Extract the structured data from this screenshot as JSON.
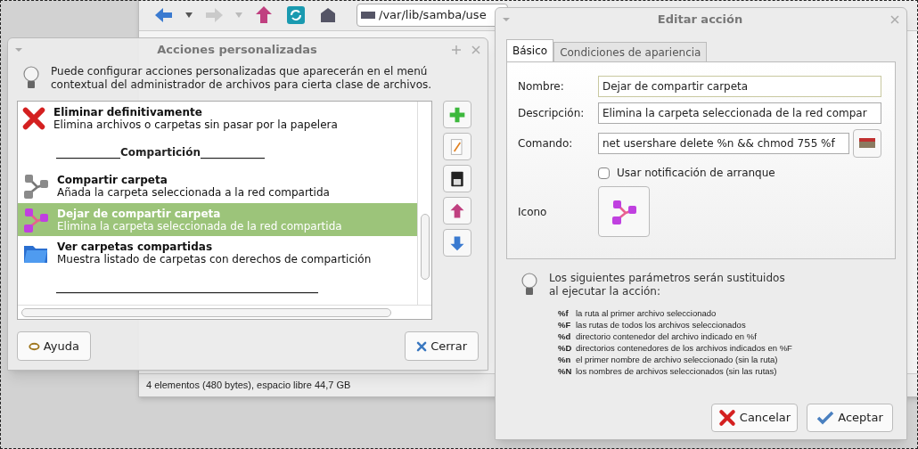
{
  "file_manager": {
    "path": "/var/lib/samba/use",
    "status": "4 elementos (480 bytes), espacio libre 44,7 GB"
  },
  "actions_dialog": {
    "title": "Acciones personalizadas",
    "intro": "Puede configurar acciones personalizadas que aparecerán en el menú contextual del administrador de archivos para cierta clase de archivos.",
    "items": [
      {
        "kind": "action",
        "title": "Eliminar definitivamente",
        "description": "Elimina archivos o carpetas sin pasar por la papelera",
        "selected": false
      },
      {
        "kind": "separator",
        "title": "____________Compartición____________",
        "selected": false
      },
      {
        "kind": "action",
        "title": "Compartir carpeta",
        "description": "Añada la carpeta seleccionada a la red compartida",
        "selected": false
      },
      {
        "kind": "action",
        "title": "Dejar de compartir carpeta",
        "description": "Elimina la carpeta seleccionada de la red compartida",
        "selected": true
      },
      {
        "kind": "action",
        "title": "Ver carpetas compartidas",
        "description": "Muestra listado de carpetas con derechos de compartición",
        "selected": false
      },
      {
        "kind": "separator",
        "title": "_________________________________________________",
        "selected": false
      }
    ],
    "buttons": [
      {
        "label": "Ayuda"
      },
      {
        "label": "Cerrar"
      }
    ]
  },
  "edit_dialog": {
    "title": "Editar acción",
    "tabs": [
      {
        "label": "Básico",
        "selected": true
      },
      {
        "label": "Condiciones de apariencia",
        "selected": false
      }
    ],
    "fields": [
      {
        "label": "Nombre:",
        "value": "Dejar de compartir carpeta"
      },
      {
        "label": "Descripción:",
        "value": "Elimina la carpeta seleccionada de la red compar"
      },
      {
        "label": "Comando:",
        "value": "net usershare delete %n && chmod 755 %f"
      }
    ],
    "startup_notification": {
      "label": "Usar notificación de arranque",
      "checked": false
    },
    "icon_label": "Icono",
    "info": "Los siguientes parámetros serán sustituidos al ejecutar la acción:",
    "parameters": [
      {
        "code": "%f",
        "text": "la ruta al primer archivo seleccionado"
      },
      {
        "code": "%F",
        "text": "las rutas de todos los archivos seleccionados"
      },
      {
        "code": "%d",
        "text": "directorio contenedor del archivo indicado en %f"
      },
      {
        "code": "%D",
        "text": "directorios contenedores de los archivos indicados en %F"
      },
      {
        "code": "%n",
        "text": "el primer nombre de archivo seleccionado (sin la ruta)"
      },
      {
        "code": "%N",
        "text": "los nombres de archivos seleccionados (sin las rutas)"
      }
    ],
    "buttons": [
      {
        "label": "Cancelar"
      },
      {
        "label": "Aceptar"
      }
    ]
  }
}
